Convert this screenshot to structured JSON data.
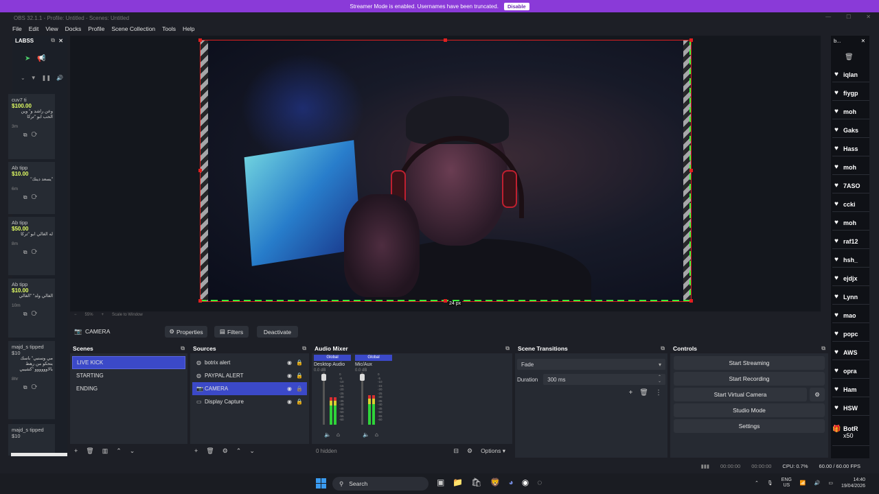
{
  "banner": {
    "text": "Streamer Mode is enabled. Usernames have been truncated.",
    "button": "Disable"
  },
  "window": {
    "title": "OBS 32.1.1 - Profile: Untitled - Scenes: Untitled"
  },
  "menu": [
    "File",
    "Edit",
    "View",
    "Docks",
    "Profile",
    "Scene Collection",
    "Tools",
    "Help"
  ],
  "labs": {
    "title": "LABSS",
    "tips": [
      {
        "name": "cuv7 ti",
        "amount": "$100.00",
        "message": "وعن راشد و\" وين الحب ابو \"تركا",
        "time": "3m"
      },
      {
        "name": "Ab tipp",
        "amount": "$10.00",
        "message": "\"يسعد دينك\"",
        "time": "6m"
      },
      {
        "name": "Ab tipp",
        "amount": "$50.00",
        "message": "له الغالي ابو \"تركا",
        "time": "8m"
      },
      {
        "name": "Ab tipp",
        "amount": "$10.00",
        "message": "الغالي ولد\" \"الغالي",
        "time": "10m"
      },
      {
        "name": "majd_s tipped $10",
        "amount": "",
        "message": "مي وسنبي\" باسك بتحكو من رهط بالاوووووو \"كشيبي",
        "time": "8hr"
      },
      {
        "name": "majd_s tipped $10",
        "amount": "",
        "message": "",
        "time": ""
      }
    ]
  },
  "preview": {
    "measure_label": "24 px",
    "zoom_controls": [
      "−",
      "55%",
      "+",
      "Scale to Window"
    ]
  },
  "chat": {
    "title": "b...",
    "users": [
      "iqlan",
      "fiygp",
      "moh",
      "Gaks",
      "Hass",
      "moh",
      "7ASO",
      "ccki",
      "moh",
      "raf12",
      "hsh_",
      "ejdjx",
      "Lynn",
      "mao",
      "popc",
      "AWS",
      "opra",
      "Ham",
      "HSW"
    ],
    "gift": {
      "name": "BotR",
      "count": "x50"
    }
  },
  "source_bar": {
    "selected": "CAMERA",
    "properties": "Properties",
    "filters": "Filters",
    "deactivate": "Deactivate"
  },
  "scenes": {
    "title": "Scenes",
    "items": [
      "LIVE KICK",
      "STARTING",
      "ENDING"
    ],
    "selected_index": 0
  },
  "sources": {
    "title": "Sources",
    "items": [
      {
        "name": "botrix alert",
        "icon": "globe-icon"
      },
      {
        "name": "PAYPAL ALERT",
        "icon": "globe-icon"
      },
      {
        "name": "CAMERA",
        "icon": "camera-icon"
      },
      {
        "name": "Display Capture",
        "icon": "monitor-icon"
      }
    ],
    "selected_index": 2
  },
  "mixer": {
    "title": "Audio Mixer",
    "channels": [
      {
        "badge": "Global",
        "name": "Desktop Audio",
        "db": "0.0 dB",
        "level": 0.55
      },
      {
        "badge": "Global",
        "name": "Mic/Aux",
        "db": "0.0 dB",
        "level": 0.6
      }
    ],
    "scale": [
      "0",
      "-5",
      "-10",
      "-15",
      "-20",
      "-25",
      "-30",
      "-35",
      "-40",
      "-45",
      "-50",
      "-55",
      "-60"
    ],
    "hidden": "0 hidden",
    "options": "Options"
  },
  "transitions": {
    "title": "Scene Transitions",
    "type": "Fade",
    "duration_label": "Duration",
    "duration": "300 ms"
  },
  "controls": {
    "title": "Controls",
    "buttons": [
      "Start Streaming",
      "Start Recording",
      "Start Virtual Camera",
      "Studio Mode",
      "Settings"
    ]
  },
  "status": {
    "rec_time": "00:00:00",
    "stream_time": "00:00:00",
    "cpu": "CPU: 0.7%",
    "fps": "60.00 / 60.00 FPS"
  },
  "taskbar": {
    "search": "Search",
    "lang_top": "ENG",
    "lang_bottom": "US",
    "time": "14:40",
    "date": "19/04/2026",
    "accent": "#3a9bf0"
  },
  "colors": {
    "banner": "#8a3ad8",
    "selection": "#3b49c8",
    "tip_amount": "#e3ff64"
  }
}
